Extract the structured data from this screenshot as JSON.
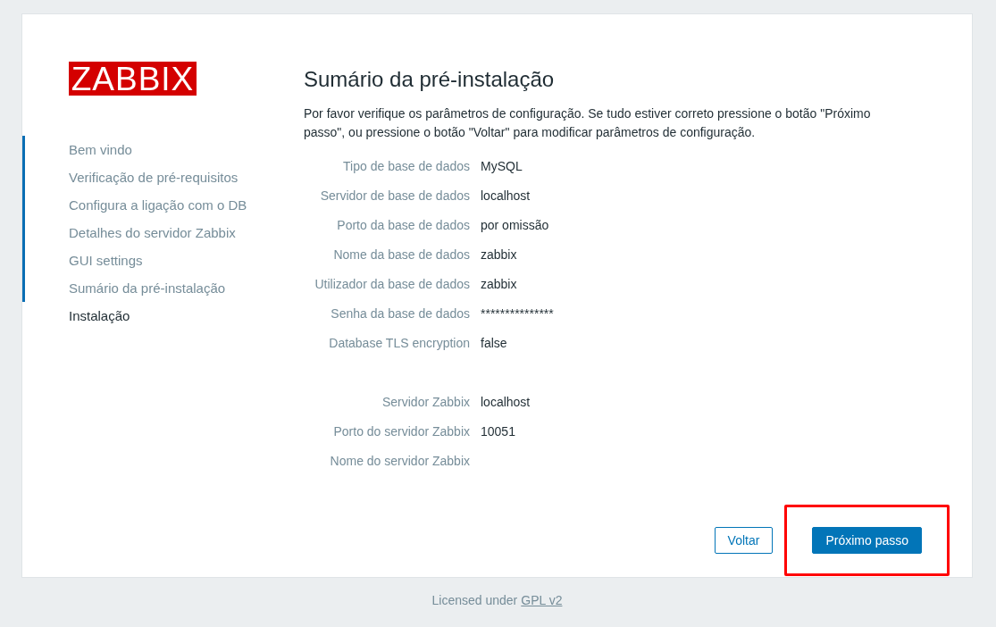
{
  "logo": {
    "text": "ZABBIX"
  },
  "steps": [
    {
      "label": "Bem vindo",
      "done": true
    },
    {
      "label": "Verificação de pré-requisitos",
      "done": true
    },
    {
      "label": "Configura a ligação com o DB",
      "done": true
    },
    {
      "label": "Detalhes do servidor Zabbix",
      "done": true
    },
    {
      "label": "GUI settings",
      "done": true
    },
    {
      "label": "Sumário da pré-instalação",
      "done": true
    },
    {
      "label": "Instalação",
      "done": false
    }
  ],
  "title": "Sumário da pré-instalação",
  "intro": "Por favor verifique os parâmetros de configuração. Se tudo estiver correto pressione o botão \"Próximo passo\", ou pressione o botão \"Voltar\" para modificar parâmetros de configuração.",
  "groups": [
    [
      {
        "label": "Tipo de base de dados",
        "value": "MySQL"
      },
      {
        "label": "Servidor de base de dados",
        "value": "localhost"
      },
      {
        "label": "Porto da base de dados",
        "value": "por omissão"
      },
      {
        "label": "Nome da base de dados",
        "value": "zabbix"
      },
      {
        "label": "Utilizador da base de dados",
        "value": "zabbix"
      },
      {
        "label": "Senha da base de dados",
        "value": "***************"
      },
      {
        "label": "Database TLS encryption",
        "value": "false"
      }
    ],
    [
      {
        "label": "Servidor Zabbix",
        "value": "localhost"
      },
      {
        "label": "Porto do servidor Zabbix",
        "value": "10051"
      },
      {
        "label": "Nome do servidor Zabbix"
      }
    ]
  ],
  "buttons": [
    {
      "label": "Voltar",
      "kind": "secondary",
      "highlighted": false
    },
    {
      "label": "Próximo passo",
      "kind": "primary",
      "highlighted": true
    }
  ],
  "footer": {
    "text": "Licensed under",
    "link": "GPL v2"
  }
}
